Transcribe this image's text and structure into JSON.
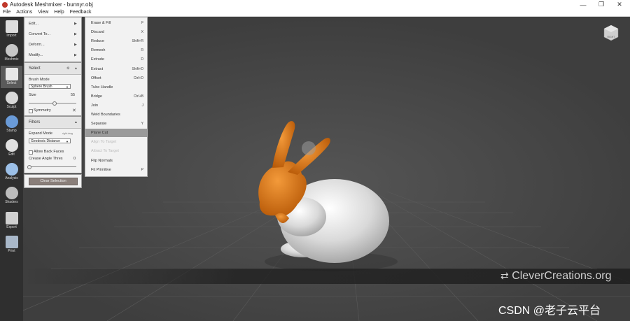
{
  "window": {
    "title": "Autodesk Meshmixer - bunnyr.obj"
  },
  "menubar": {
    "items": [
      "File",
      "Actions",
      "View",
      "Help",
      "Feedback"
    ]
  },
  "toolbar": {
    "items": [
      {
        "label": "Import",
        "icon": "import-icon"
      },
      {
        "label": "Meshmix",
        "icon": "meshmix-icon"
      },
      {
        "label": "Select",
        "icon": "select-icon"
      },
      {
        "label": "Sculpt",
        "icon": "sculpt-icon"
      },
      {
        "label": "Stamp",
        "icon": "stamp-icon"
      },
      {
        "label": "Edit",
        "icon": "edit-icon"
      },
      {
        "label": "Analysis",
        "icon": "analysis-icon"
      },
      {
        "label": "Shaders",
        "icon": "shaders-icon"
      },
      {
        "label": "Export",
        "icon": "export-icon"
      },
      {
        "label": "Print",
        "icon": "print-icon"
      }
    ],
    "active": "Select"
  },
  "edit_panel": {
    "items": [
      "Edit...",
      "Convert To...",
      "Deform...",
      "Modify..."
    ]
  },
  "select_panel": {
    "title": "Select",
    "brush_mode_label": "Brush Mode",
    "brush_mode_value": "Sphere Brush",
    "size_label": "Size",
    "size_value": "55",
    "size_fraction": 0.53,
    "symmetry_label": "Symmetry"
  },
  "filters_panel": {
    "title": "Filters",
    "expand_mode_label": "Expand Mode",
    "expand_mode_hint": "right-drag",
    "expand_mode_value": "Geodesic Distance",
    "allow_back_faces_label": "Allow Back Faces",
    "crease_angle_label": "Crease Angle Thres",
    "crease_angle_value": "0",
    "crease_fraction": 0.0
  },
  "clear_selection_label": "Clear Selection",
  "submenu": {
    "items": [
      {
        "label": "Erase & Fill",
        "shortcut": "F",
        "state": "normal"
      },
      {
        "label": "Discard",
        "shortcut": "X",
        "state": "normal"
      },
      {
        "label": "Reduce",
        "shortcut": "Shift+R",
        "state": "normal"
      },
      {
        "label": "Remesh",
        "shortcut": "R",
        "state": "normal"
      },
      {
        "label": "Extrude",
        "shortcut": "D",
        "state": "normal"
      },
      {
        "label": "Extract",
        "shortcut": "Shift+D",
        "state": "normal"
      },
      {
        "label": "Offset",
        "shortcut": "Ctrl+D",
        "state": "normal"
      },
      {
        "label": "Tube Handle",
        "shortcut": "",
        "state": "normal"
      },
      {
        "label": "Bridge",
        "shortcut": "Ctrl+B",
        "state": "normal"
      },
      {
        "label": "Join",
        "shortcut": "J",
        "state": "normal"
      },
      {
        "label": "Weld Boundaries",
        "shortcut": "",
        "state": "normal"
      },
      {
        "label": "Separate",
        "shortcut": "Y",
        "state": "normal"
      },
      {
        "label": "Plane Cut",
        "shortcut": "",
        "state": "highlighted"
      },
      {
        "label": "Align To Target",
        "shortcut": "",
        "state": "disabled"
      },
      {
        "label": "Attract To Target",
        "shortcut": "",
        "state": "disabled"
      },
      {
        "label": "Flip Normals",
        "shortcut": "",
        "state": "normal"
      },
      {
        "label": "Fit Primitive",
        "shortcut": "P",
        "state": "normal"
      }
    ]
  },
  "viewcube": {
    "label": "RIGHT"
  },
  "watermark": {
    "text": "CleverCreations.org"
  },
  "credit": {
    "text": "CSDN @老子云平台"
  },
  "colors": {
    "selection": "#e07a12",
    "mesh": "#e6e6e6",
    "viewport": "#3e3e3e"
  }
}
